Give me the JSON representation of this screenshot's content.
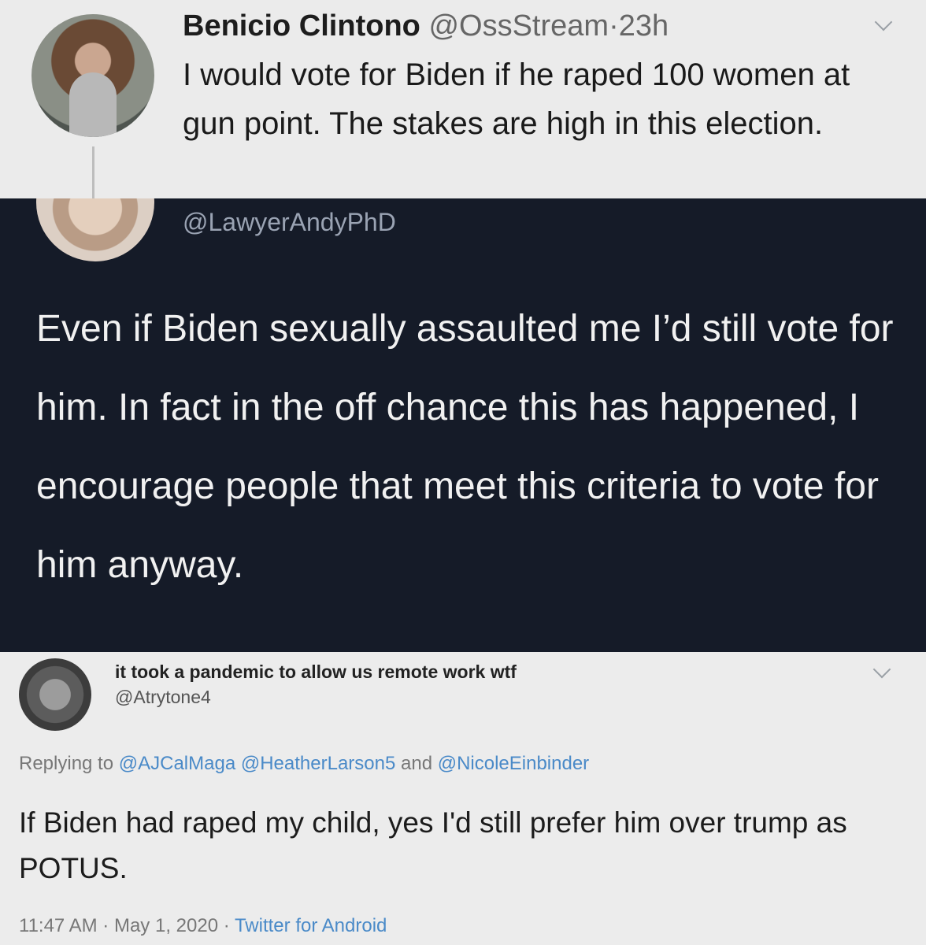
{
  "tweet1": {
    "name": "Benicio Clintono",
    "handle": "@OssStream",
    "separator": "·",
    "time": "23h",
    "text": "I would vote for Biden if he raped 100 women at gun point. The stakes are high in this election."
  },
  "tweet2": {
    "handle": "@LawyerAndyPhD",
    "text": "Even if Biden sexually assaulted me I’d still vote for him. In fact in the off chance this has happened, I encourage people that meet this criteria to vote for him anyway."
  },
  "tweet3": {
    "name": "it took a pandemic to allow us remote work wtf",
    "handle": "@Atrytone4",
    "replying_prefix": "Replying to",
    "mention1": "@AJCalMaga",
    "mention2": "@HeatherLarson5",
    "replying_and": "and",
    "mention3": "@NicoleEinbinder",
    "text": "If Biden had raped my child, yes I'd still prefer him over trump as POTUS.",
    "time": "11:47 AM",
    "date": "May 1, 2020",
    "source": "Twitter for Android",
    "separator": "·"
  },
  "colors": {
    "dark_panel": "#151b28",
    "link": "#4a8ac8",
    "muted": "#777777"
  },
  "icons": [
    "chevron-down-icon",
    "avatar"
  ]
}
